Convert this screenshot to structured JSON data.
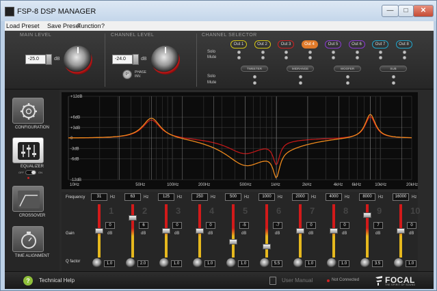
{
  "window": {
    "title": "FSP-8 DSP MANAGER",
    "min": "—",
    "max": "□",
    "close": "✕"
  },
  "menu": [
    "Load Preset",
    "Save Preset",
    "Function",
    "?"
  ],
  "main_level": {
    "title": "MAIN LEVEL",
    "value": "-25.0",
    "unit": "dB"
  },
  "channel_level": {
    "title": "CHANNEL LEVEL",
    "value": "-24.0",
    "unit": "dB",
    "phase": "PHASE INV.",
    "phase_icon": "0°"
  },
  "channel_selector": {
    "title": "CHANNEL SELECTOR",
    "solo": "Solo",
    "mute": "Mute",
    "outputs": [
      {
        "label": "Out 1",
        "color": "#d4c516"
      },
      {
        "label": "Out 2",
        "color": "#d4c516"
      },
      {
        "label": "Out 3",
        "color": "#cc2222"
      },
      {
        "label": "Out 4",
        "color": "#e07a2a",
        "active": true
      },
      {
        "label": "Out 5",
        "color": "#8a3ad0"
      },
      {
        "label": "Out 6",
        "color": "#8a3ad0"
      },
      {
        "label": "Out 7",
        "color": "#22a6cc"
      },
      {
        "label": "Out 8",
        "color": "#22a6cc"
      }
    ],
    "groups": [
      "TWEETER",
      "MIDRANGE",
      "WOOFER",
      "SUB"
    ]
  },
  "sidebar": [
    {
      "label": "CONFIGURATION",
      "icon": "gear-icon"
    },
    {
      "label": "EQUALIZER",
      "icon": "equalizer-icon",
      "active": true
    },
    {
      "label": "CROSSOVER",
      "icon": "crossover-icon"
    },
    {
      "label": "TIME ALIGNMENT",
      "icon": "stopwatch-icon"
    }
  ],
  "eq_toggle": {
    "off": "OFF",
    "on": "ON"
  },
  "graph": {
    "y_labels": [
      "+12dB",
      "+6dB",
      "+3dB",
      "0",
      "-3dB",
      "-6dB",
      "-12dB"
    ],
    "x_labels": [
      "10Hz",
      "50Hz",
      "100Hz",
      "200Hz",
      "500Hz",
      "1kHz",
      "2kHz",
      "4kHz",
      "6kHz",
      "10kHz",
      "20kHz"
    ]
  },
  "bands": {
    "freq_label": "Frequency",
    "gain_label": "Gain",
    "q_label": "Q factor",
    "hz": "Hz",
    "db": "dB",
    "items": [
      {
        "freq": "31",
        "gain": "0",
        "q": "1.0",
        "num": "1"
      },
      {
        "freq": "63",
        "gain": "6",
        "q": "2.0",
        "num": "2"
      },
      {
        "freq": "125",
        "gain": "0",
        "q": "1.0",
        "num": "3"
      },
      {
        "freq": "250",
        "gain": "0",
        "q": "1.0",
        "num": "4"
      },
      {
        "freq": "500",
        "gain": "-5",
        "q": "1.0",
        "num": "5"
      },
      {
        "freq": "1000",
        "gain": "-7",
        "q": "5.5",
        "num": "6"
      },
      {
        "freq": "2000",
        "gain": "0",
        "q": "1.0",
        "num": "7"
      },
      {
        "freq": "4000",
        "gain": "0",
        "q": "1.0",
        "num": "8"
      },
      {
        "freq": "8000",
        "gain": "7",
        "q": "3.5",
        "num": "9"
      },
      {
        "freq": "16000",
        "gain": "0",
        "q": "1.0",
        "num": "10"
      }
    ]
  },
  "footer": {
    "help": "Technical Help",
    "help_icon": "?",
    "manual": "User Manual",
    "status": "Not Connected",
    "logo": "FOCAL",
    "tagline": "THE SPIRIT OF SOUND"
  }
}
